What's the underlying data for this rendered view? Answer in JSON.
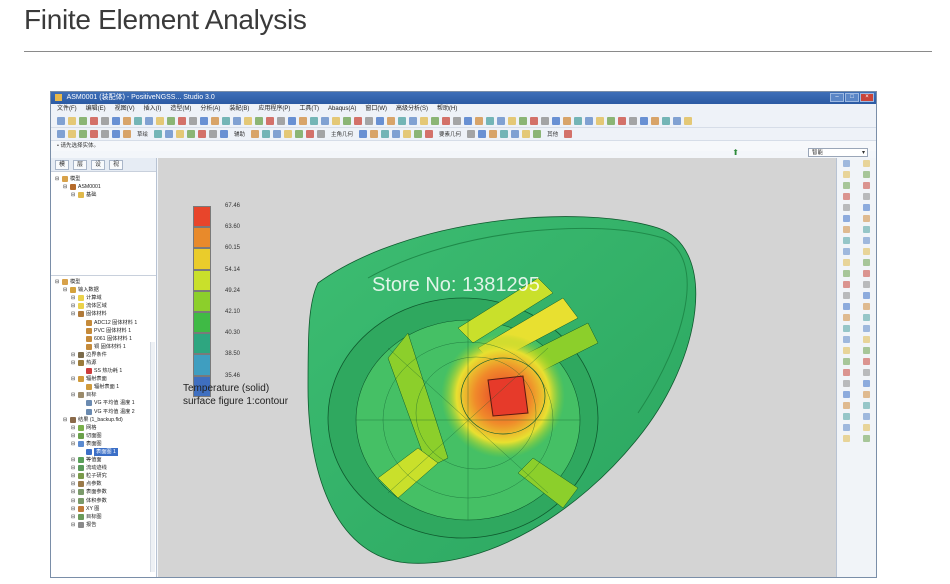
{
  "page": {
    "title": "Finite Element Analysis"
  },
  "window": {
    "title": "ASM0001 (装配体) - PositiveNGSS... Studio 3.0",
    "minimize": "–",
    "maximize": "□",
    "close": "×"
  },
  "menu": [
    "文件(F)",
    "编辑(E)",
    "视图(V)",
    "插入(I)",
    "造型(M)",
    "分析(A)",
    "装配(B)",
    "应用程序(P)",
    "工具(T)",
    "Abaqus(A)",
    "窗口(W)",
    "高级分析(S)",
    "帮助(H)"
  ],
  "toolbar2_texts": [
    "草绘",
    "辅助",
    "主角几何",
    "要素几何",
    "其他"
  ],
  "hint": "• 请先选择实体。",
  "status_select": "智能",
  "panel_tabs": [
    "模",
    "层",
    "设",
    "视"
  ],
  "model_tree": [
    {
      "label": "模型",
      "depth": 0,
      "color": "#d8a24a"
    },
    {
      "label": "ASM0001",
      "depth": 1,
      "color": "#b56a2a"
    },
    {
      "label": "基础",
      "depth": 2,
      "color": "#e0b94b"
    }
  ],
  "sim_tree": [
    {
      "label": "模型",
      "depth": 0,
      "color": "#d8a24a"
    },
    {
      "label": "输入数据",
      "depth": 1,
      "color": "#d4a23c"
    },
    {
      "label": "计算域",
      "depth": 2,
      "color": "#ebd24a"
    },
    {
      "label": "流体区域",
      "depth": 2,
      "color": "#ebd24a"
    },
    {
      "label": "固体材料",
      "depth": 2,
      "color": "#b07a3a"
    },
    {
      "label": "ADC12 固体材料 1",
      "depth": 3,
      "color": "#c58a3a"
    },
    {
      "label": "PVC 固体材料 1",
      "depth": 3,
      "color": "#c58a3a"
    },
    {
      "label": "6061 固体材料 1",
      "depth": 3,
      "color": "#c58a3a"
    },
    {
      "label": "铜 固体材料 1",
      "depth": 3,
      "color": "#c58a3a"
    },
    {
      "label": "边界条件",
      "depth": 2,
      "color": "#7a6a4a"
    },
    {
      "label": "热源",
      "depth": 2,
      "color": "#9a7a3a"
    },
    {
      "label": "SS 热功耗 1",
      "depth": 3,
      "color": "#cc3b3b"
    },
    {
      "label": "辐射表面",
      "depth": 2,
      "color": "#d09a3a"
    },
    {
      "label": "辐射表面 1",
      "depth": 3,
      "color": "#d09a3a"
    },
    {
      "label": "目标",
      "depth": 2,
      "color": "#9a8a6a"
    },
    {
      "label": "VG 平均值 温度 1",
      "depth": 3,
      "color": "#6a8ab0"
    },
    {
      "label": "VG 平均值 温度 2",
      "depth": 3,
      "color": "#6a8ab0"
    },
    {
      "label": "结果 (1_backup.fld)",
      "depth": 1,
      "color": "#8a6a4a"
    },
    {
      "label": "网格",
      "depth": 2,
      "color": "#7ab04a"
    },
    {
      "label": "切面图",
      "depth": 2,
      "color": "#6aa04a"
    },
    {
      "label": "表面图",
      "depth": 2,
      "color": "#5a8ad0"
    },
    {
      "label": "表面图 1",
      "depth": 3,
      "color": "#3b6fc7",
      "selected": true
    },
    {
      "label": "等值面",
      "depth": 2,
      "color": "#5aa05a"
    },
    {
      "label": "流动迹线",
      "depth": 2,
      "color": "#5a9a5a"
    },
    {
      "label": "粒子研究",
      "depth": 2,
      "color": "#7a9a4a"
    },
    {
      "label": "点参数",
      "depth": 2,
      "color": "#9a7a4a"
    },
    {
      "label": "表面参数",
      "depth": 2,
      "color": "#7a9a6a"
    },
    {
      "label": "体积参数",
      "depth": 2,
      "color": "#7a9a6a"
    },
    {
      "label": "XY 图",
      "depth": 2,
      "color": "#c07a3a"
    },
    {
      "label": "目标图",
      "depth": 2,
      "color": "#6a9a5a"
    },
    {
      "label": "报告",
      "depth": 2,
      "color": "#8a8a8a"
    }
  ],
  "legend": {
    "values": [
      "67.46",
      "63.60",
      "60.15",
      "54.14",
      "49.24",
      "42.10",
      "40.30",
      "38.50",
      "35.46"
    ],
    "colors": [
      "#e8452b",
      "#e88a2b",
      "#eacc2b",
      "#c9e02b",
      "#8ccf2b",
      "#3fba45",
      "#2ea680",
      "#3f9ec0",
      "#3f6fc0"
    ],
    "caption_line1": "Temperature (solid)",
    "caption_line2": "surface figure 1:contour"
  },
  "watermark": "Store No: 1381295",
  "colors": {
    "model_green": "#34b06a",
    "model_dark_green": "#1f8a4a",
    "hot_red": "#e63a2a",
    "warm_orange": "#f08a2a",
    "yellow": "#e8e030"
  }
}
